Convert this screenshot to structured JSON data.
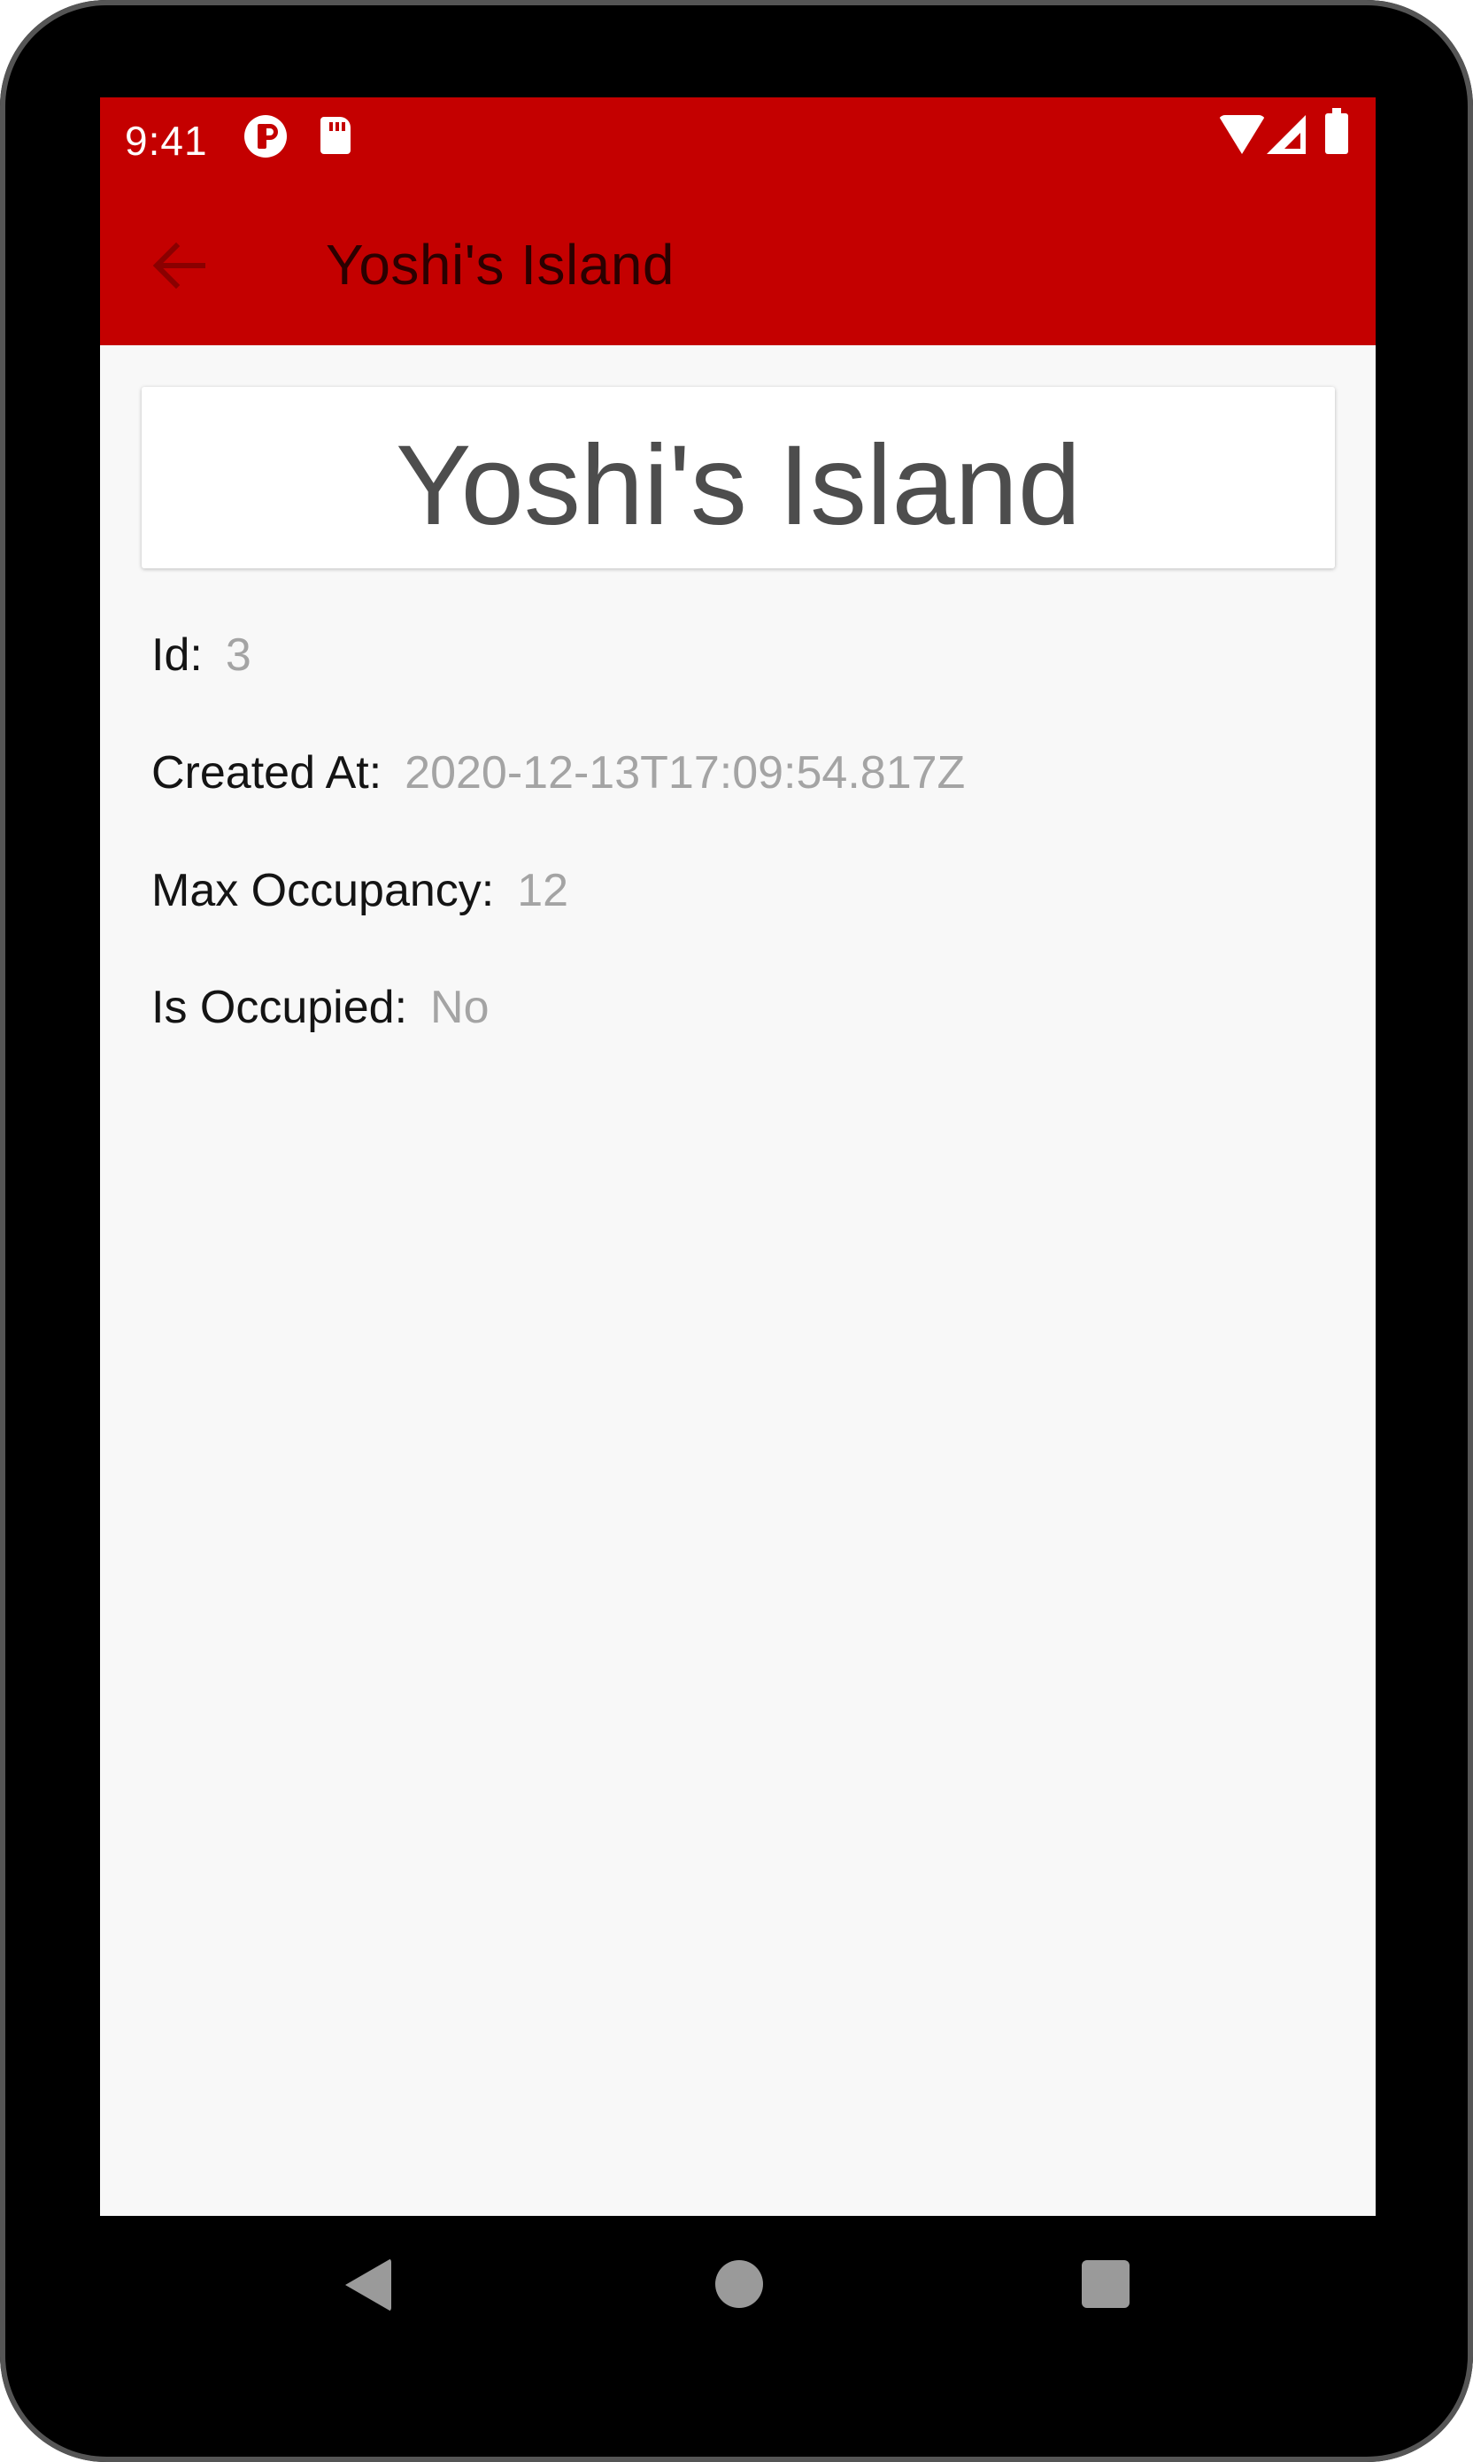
{
  "status_bar": {
    "time": "9:41",
    "icons": [
      "app-notification-icon",
      "sd-card-icon",
      "wifi-icon",
      "cell-signal-icon",
      "battery-icon"
    ]
  },
  "app_bar": {
    "back_icon": "arrow-back-icon",
    "title": "Yoshi's Island"
  },
  "detail": {
    "heading": "Yoshi's Island",
    "fields": [
      {
        "label": "Id:",
        "value": "3"
      },
      {
        "label": "Created At:",
        "value": "2020-12-13T17:09:54.817Z"
      },
      {
        "label": "Max Occupancy:",
        "value": "12"
      },
      {
        "label": "Is Occupied:",
        "value": "No"
      }
    ]
  },
  "nav_bar": {
    "back_icon": "triangle-back-icon",
    "home_icon": "circle-home-icon",
    "recents_icon": "square-recents-icon"
  },
  "colors": {
    "primary": "#c40000",
    "app_title": "#2b0000",
    "background": "#f8f8f8",
    "label": "#141414",
    "value": "#a4a4a4",
    "heading": "#4d4d4d"
  }
}
